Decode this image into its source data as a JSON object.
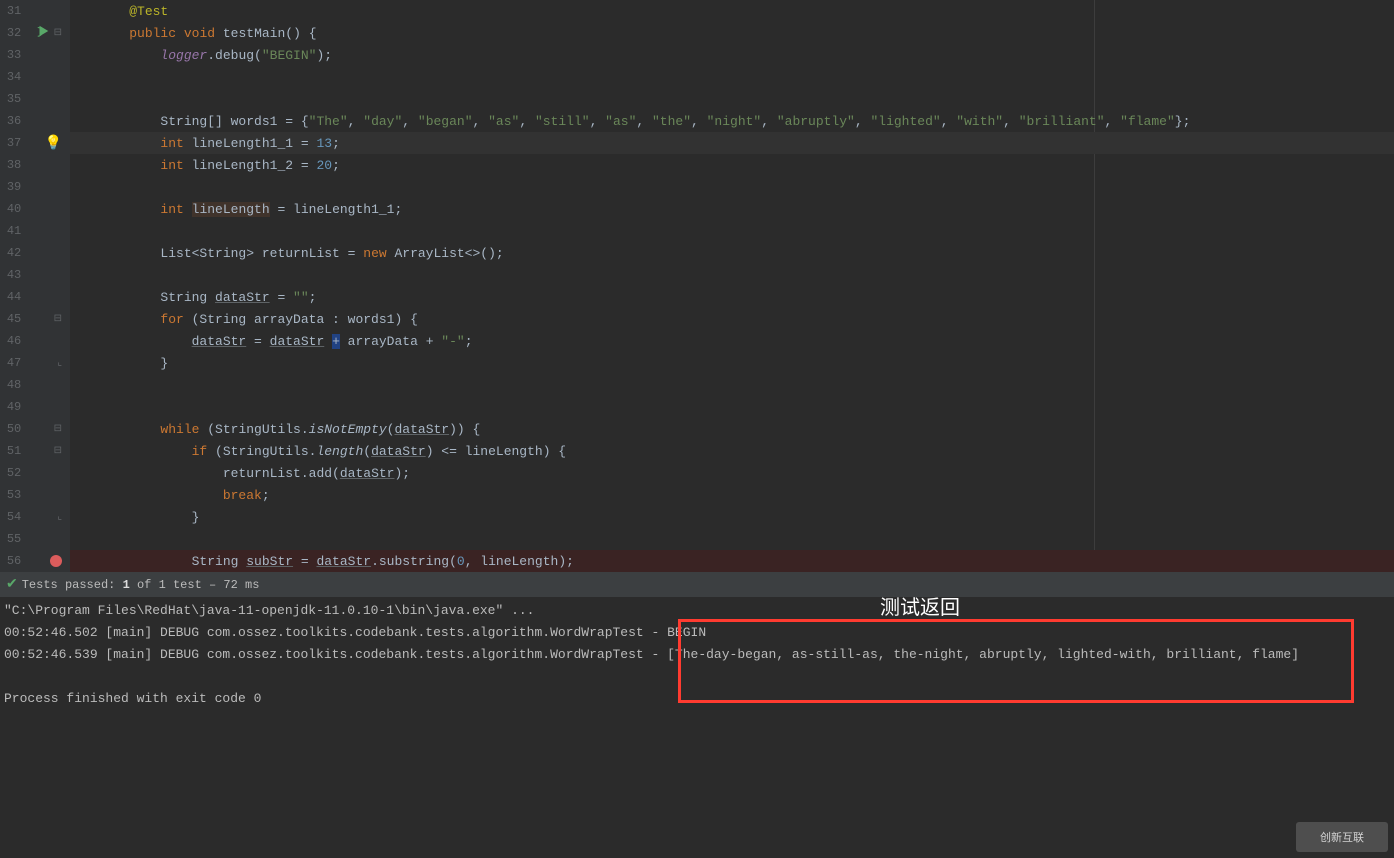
{
  "editor": {
    "lines": {
      "31": {
        "num": "31"
      },
      "32": {
        "num": "32"
      },
      "33": {
        "num": "33"
      },
      "34": {
        "num": "34"
      },
      "35": {
        "num": "35"
      },
      "36": {
        "num": "36"
      },
      "37": {
        "num": "37"
      },
      "38": {
        "num": "38"
      },
      "39": {
        "num": "39"
      },
      "40": {
        "num": "40"
      },
      "41": {
        "num": "41"
      },
      "42": {
        "num": "42"
      },
      "43": {
        "num": "43"
      },
      "44": {
        "num": "44"
      },
      "45": {
        "num": "45"
      },
      "46": {
        "num": "46"
      },
      "47": {
        "num": "47"
      },
      "48": {
        "num": "48"
      },
      "49": {
        "num": "49"
      },
      "50": {
        "num": "50"
      },
      "51": {
        "num": "51"
      },
      "52": {
        "num": "52"
      },
      "53": {
        "num": "53"
      },
      "54": {
        "num": "54"
      },
      "55": {
        "num": "55"
      },
      "56": {
        "num": "56"
      }
    },
    "code": {
      "l31_ann": "@Test",
      "l32_public": "public",
      "l32_void": "void",
      "l32_name": "testMain",
      "l32_paren": "() {",
      "l33_logger": "logger",
      "l33_debug": ".debug(",
      "l33_str": "\"BEGIN\"",
      "l33_end": ");",
      "l36_a": "String[] words1 = {",
      "l36_s1": "\"The\"",
      "l36_c": ", ",
      "l36_s2": "\"day\"",
      "l36_s3": "\"began\"",
      "l36_s4": "\"as\"",
      "l36_s5": "\"still\"",
      "l36_s6": "\"as\"",
      "l36_s7": "\"the\"",
      "l36_s8": "\"night\"",
      "l36_s9": "\"abruptly\"",
      "l36_s10": "\"lighted\"",
      "l36_s11": "\"with\"",
      "l36_s12": "\"brilliant\"",
      "l36_s13": "\"flame\"",
      "l36_end": "};",
      "l37_int": "int",
      "l37_name": " lineLength1_1 = ",
      "l37_num": "13",
      "l37_end": ";",
      "l38_int": "int",
      "l38_name": " lineLength1_2 = ",
      "l38_num": "20",
      "l38_end": ";",
      "l40_int": "int",
      "l40_sp": " ",
      "l40_ll": "lineLength",
      "l40_rest": " = lineLength1_1;",
      "l42": "List<String> returnList = ",
      "l42_new": "new",
      "l42_b": " ArrayList<>();",
      "l44_a": "String ",
      "l44_ds": "dataStr",
      "l44_eq": " = ",
      "l44_s": "\"\"",
      "l44_e": ";",
      "l45_for": "for",
      "l45_rest": " (String arrayData : words1) {",
      "l46_ds1": "dataStr",
      "l46_eq": " = ",
      "l46_ds2": "dataStr",
      "l46_sp": " ",
      "l46_plus": "+",
      "l46_mid": " arrayData + ",
      "l46_dash": "\"-\"",
      "l46_end": ";",
      "l47": "}",
      "l50_while": "while",
      "l50_a": " (StringUtils.",
      "l50_isne": "isNotEmpty",
      "l50_b": "(",
      "l50_ds": "dataStr",
      "l50_c": ")) {",
      "l51_if": "if",
      "l51_a": " (StringUtils.",
      "l51_len": "length",
      "l51_b": "(",
      "l51_ds": "dataStr",
      "l51_c": ") <= lineLength) {",
      "l52_a": "returnList.add(",
      "l52_ds": "dataStr",
      "l52_b": ");",
      "l53_break": "break",
      "l53_e": ";",
      "l54": "}",
      "l56_a": "String ",
      "l56_ss": "subStr",
      "l56_eq": " = ",
      "l56_ds": "dataStr",
      "l56_sub": ".substring(",
      "l56_z": "0",
      "l56_c": ", lineLength);"
    }
  },
  "status": {
    "passed_label": "Tests passed:",
    "passed_count": "1",
    "of_text": "of 1 test – 72 ms"
  },
  "console": {
    "l1": "\"C:\\Program Files\\RedHat\\java-11-openjdk-11.0.10-1\\bin\\java.exe\" ...",
    "l2a": "00:52:46.502 [main] DEBUG com.ossez.toolkits.codebank.tests.algorithm.WordWrapTest - ",
    "l2b": "BEGIN",
    "l3a": "00:52:46.539 [main] DEBUG com.ossez.toolkits.codebank.tests.algorithm.WordWrapTest - ",
    "l3b": "[The-day-began, as-still-as, the-night, abruptly, lighted-with, brilliant, flame]",
    "l5": "Process finished with exit code 0"
  },
  "annotation": {
    "label": "测试返回"
  },
  "watermark": {
    "text": "创新互联"
  }
}
